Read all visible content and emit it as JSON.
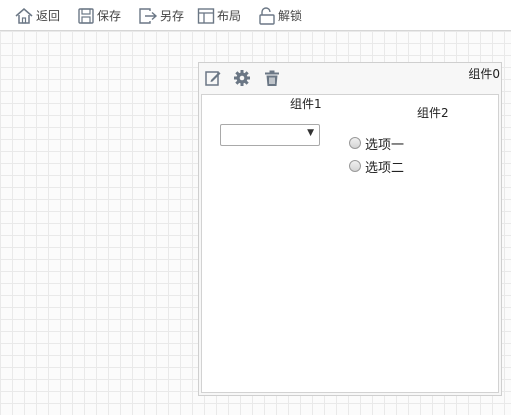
{
  "toolbar": {
    "back_label": "返回",
    "save_label": "保存",
    "saveas_label": "另存",
    "layout_label": "布局",
    "unlock_label": "解锁"
  },
  "component0": {
    "title": "组件0",
    "controls": [
      "edit-icon",
      "gear-icon",
      "trash-icon"
    ]
  },
  "component1": {
    "label": "组件1",
    "select_value": ""
  },
  "component2": {
    "label": "组件2",
    "options": [
      "选项一",
      "选项二"
    ]
  },
  "colors": {
    "icon": "#6b7785",
    "grid": "#e9e9e9",
    "border": "#cfcfcf"
  }
}
